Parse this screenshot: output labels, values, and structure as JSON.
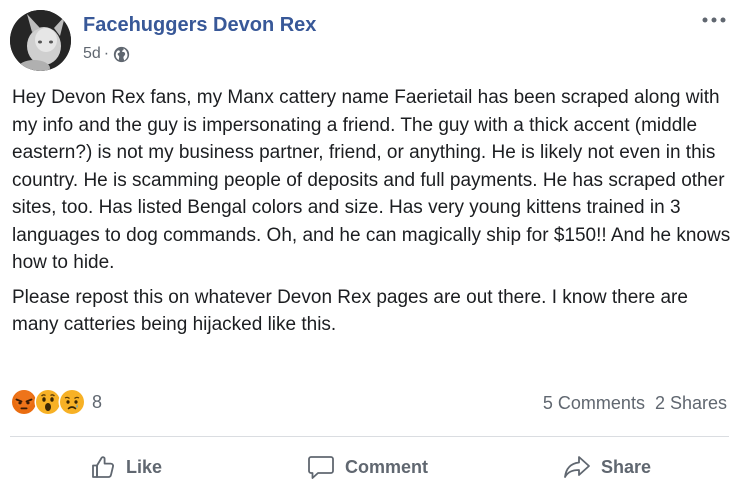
{
  "header": {
    "page_name": "Facehuggers Devon Rex",
    "time_ago": "5d",
    "separator": "·",
    "privacy_icon": "globe-icon",
    "more_icon": "more-horizontal-icon"
  },
  "post": {
    "paragraphs": [
      "Hey Devon Rex fans, my Manx cattery name Faerietail has been scraped along with my info and the guy is impersonating a friend. The guy with a thick accent (middle eastern?) is not my business partner, friend, or anything. He is likely not even in this country. He is scamming people of deposits and full payments. He has scraped other sites, too. Has listed Bengal colors and size. Has very young kittens trained in 3 languages to dog commands. Oh, and he can magically ship for $150!! And he knows how to hide.",
      "Please repost this on whatever Devon Rex pages are out there. I know there are many catteries being hijacked like this."
    ]
  },
  "reactions": {
    "icons": [
      "angry-reaction-icon",
      "wow-reaction-icon",
      "sad-reaction-icon"
    ],
    "count": "8"
  },
  "stats": {
    "comments": "5 Comments",
    "shares": "2 Shares"
  },
  "actions": {
    "like_label": "Like",
    "comment_label": "Comment",
    "share_label": "Share"
  },
  "colors": {
    "page_name": "#385898",
    "secondary_text": "#606770",
    "divider": "#dadde1",
    "angry": "#e9710f",
    "wow_sad": "#f7b125"
  }
}
